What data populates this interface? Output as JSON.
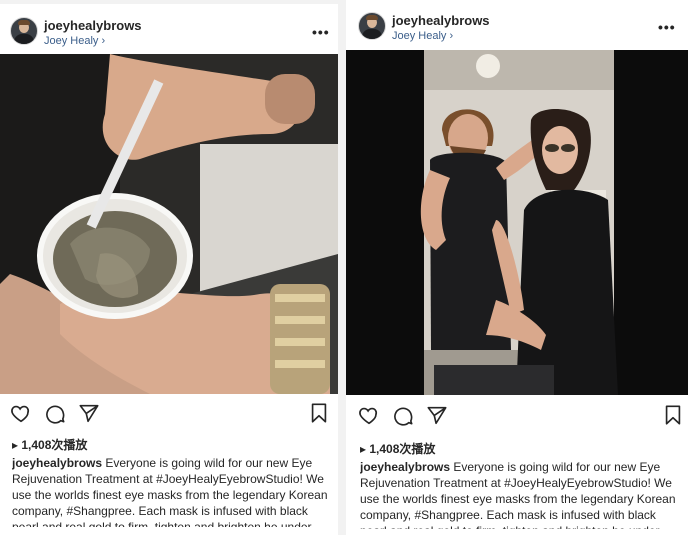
{
  "posts": [
    {
      "username": "joeyhealybrows",
      "subname": "Joey Healy",
      "subname_chevron": "›",
      "more_label": "•••",
      "views": "1,408次播放",
      "play_glyph": "▸",
      "caption_user": "joeyhealybrows",
      "caption_text": " Everyone is going wild for our new Eye Rejuvenation Treatment at #JoeyHealyEyebrowStudio! We use the worlds finest eye masks from the legendary Korean company, #Shangpree. Each mask is infused with black pearl and real gold to firm, tighten and brighten he under eye area instantly! Available to add onto any treatment"
    },
    {
      "username": "joeyhealybrows",
      "subname": "Joey Healy",
      "subname_chevron": "›",
      "more_label": "•••",
      "views": "1,408次播放",
      "play_glyph": "▸",
      "caption_user": "joeyhealybrows",
      "caption_text": " Everyone is going wild for our new Eye Rejuvenation Treatment at #JoeyHealyEyebrowStudio! We use the worlds finest eye masks from the legendary Korean company, #Shangpree. Each mask is infused with black pearl and real gold to firm, tighten and brighten he under"
    }
  ],
  "icons": [
    "heart-icon",
    "comment-icon",
    "share-icon",
    "bookmark-icon",
    "more-icon"
  ]
}
